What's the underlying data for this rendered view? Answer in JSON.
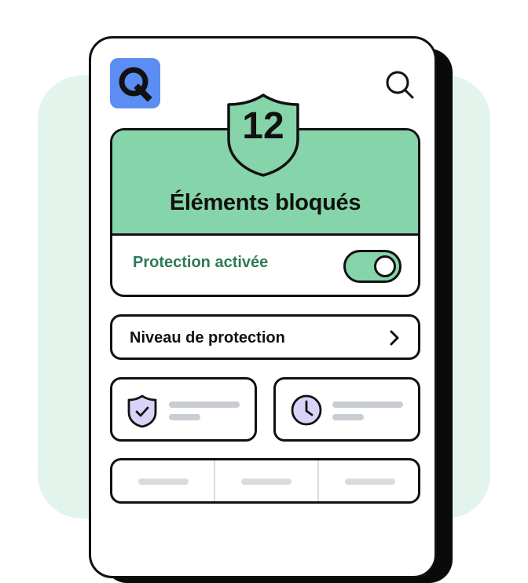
{
  "hero": {
    "count": "12",
    "title": "Éléments bloqués"
  },
  "protection": {
    "label": "Protection activée",
    "toggle_on": true
  },
  "level": {
    "label": "Niveau de protection"
  },
  "colors": {
    "accent_green": "#86d5aa",
    "dark_green_text": "#2d7a57",
    "logo_blue": "#5b8df2",
    "background_mint": "#e2f4eb",
    "placeholder_gray": "#c9cdd1",
    "shield_icon_fill": "#d9d3f7",
    "clock_icon_fill": "#d9d3f7"
  },
  "icons": {
    "logo": "q-logo",
    "search": "search-icon",
    "chevron": "chevron-right-icon",
    "card_left": "shield-check-icon",
    "card_right": "clock-icon"
  }
}
